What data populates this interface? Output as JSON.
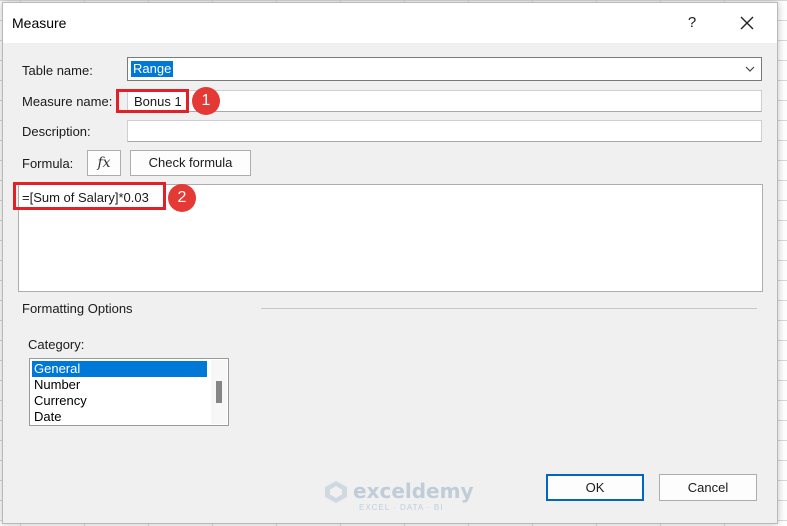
{
  "dialog": {
    "title": "Measure",
    "help_label": "?",
    "close_icon": "close-icon"
  },
  "form": {
    "table_name_label": "Table name:",
    "table_name_value": "Range",
    "measure_name_label": "Measure name:",
    "measure_name_value": "Bonus 1",
    "description_label": "Description:",
    "description_value": "",
    "formula_label": "Formula:",
    "fx_label": "fx",
    "check_formula_label": "Check formula",
    "formula_value": "=[Sum of Salary]*0.03"
  },
  "formatting": {
    "section_label": "Formatting Options",
    "category_label": "Category:",
    "categories": [
      "General",
      "Number",
      "Currency",
      "Date"
    ],
    "selected": "General"
  },
  "buttons": {
    "ok_label": "OK",
    "cancel_label": "Cancel"
  },
  "annotations": {
    "step1": "1",
    "step2": "2",
    "color": "#e32028"
  },
  "watermark": {
    "name": "exceldemy",
    "tagline": "EXCEL · DATA · BI"
  },
  "colors": {
    "selection": "#0078d7",
    "dialog_bg": "#f0f0f0",
    "default_button_border": "#0067c0"
  }
}
